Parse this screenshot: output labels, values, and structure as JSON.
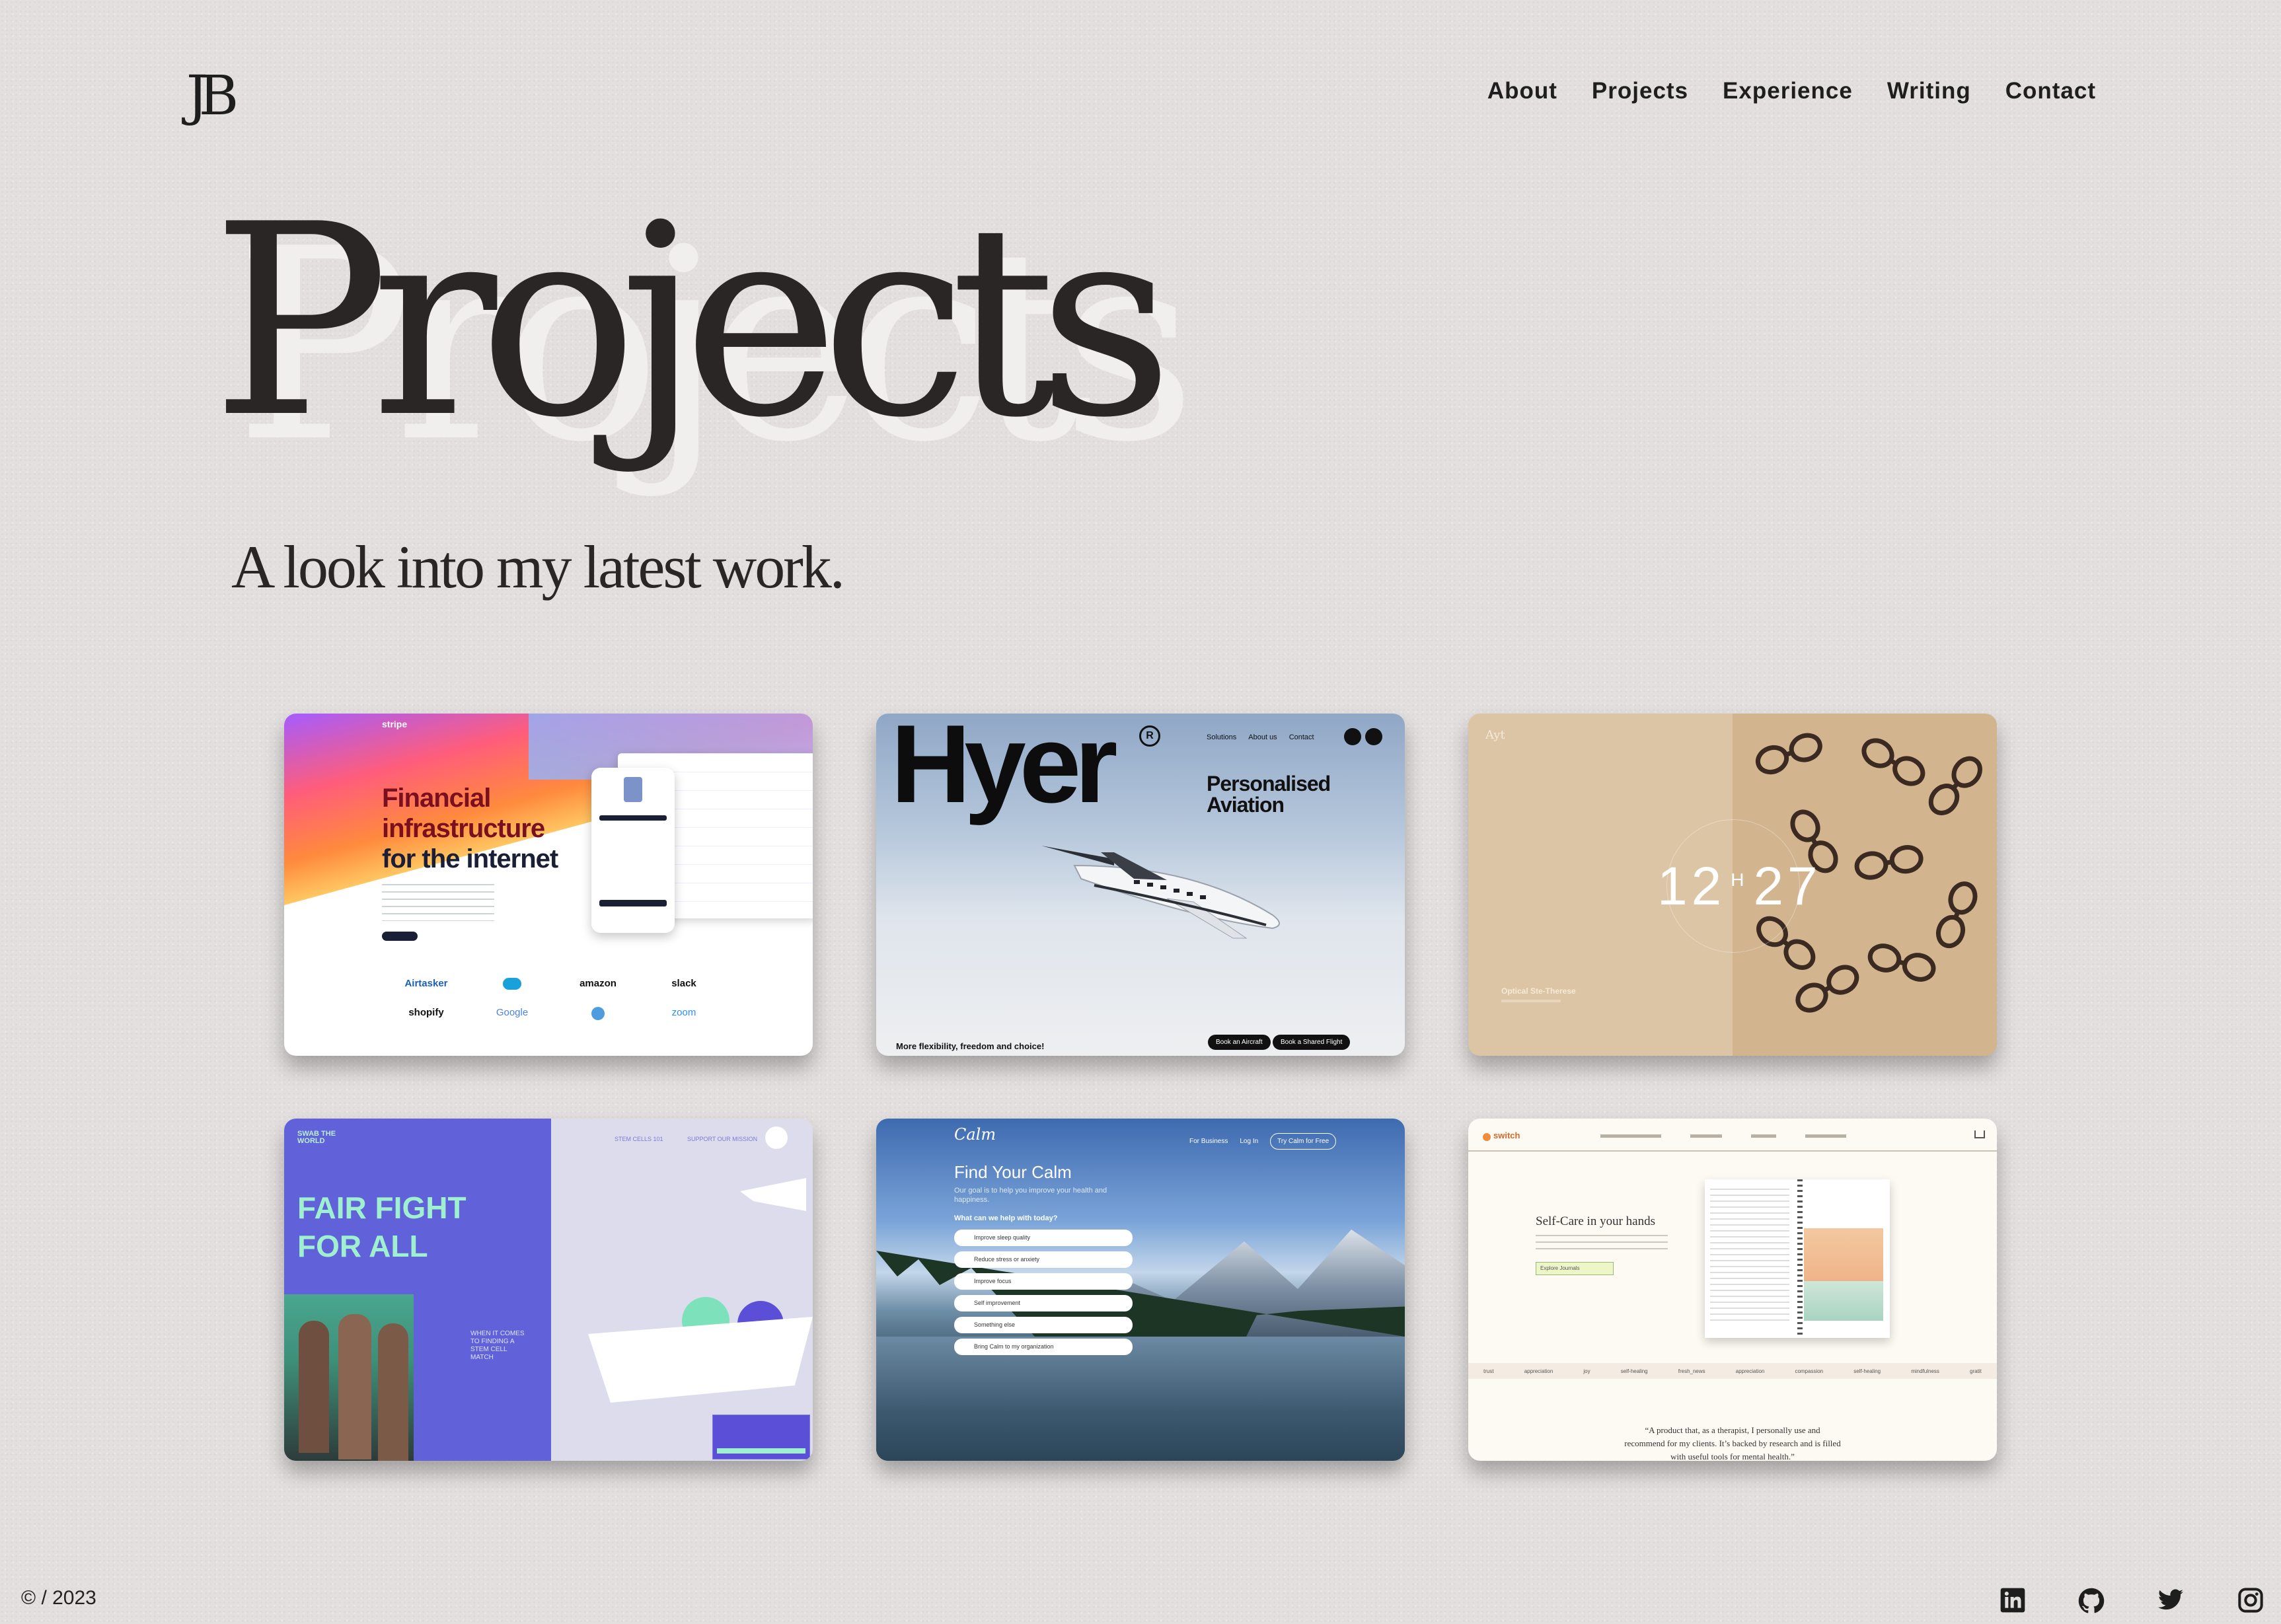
{
  "logo": "JB",
  "nav": [
    "About",
    "Projects",
    "Experience",
    "Writing",
    "Contact"
  ],
  "hero": {
    "title": "Projects",
    "subtitle": "A look into my latest work."
  },
  "projects": {
    "stripe": {
      "headline1": "Financial",
      "headline2": "infrastructure",
      "headline3": "for the internet",
      "brand": "stripe",
      "logos": [
        "Airtasker",
        "amazon",
        "slack",
        "shopify",
        "Google",
        "zoom"
      ]
    },
    "hyer": {
      "brand": "Hyer",
      "tagline1": "Personalised",
      "tagline2": "Aviation",
      "footer": "More flexibility, freedom and choice!",
      "nav": [
        "Solutions",
        "About us",
        "Contact"
      ],
      "btn1": "Book an Aircraft",
      "btn2": "Book a Shared Flight"
    },
    "optical": {
      "time": "12",
      "unit": "H",
      "minutes": "27",
      "label": "Optical Ste-Therese"
    },
    "swab": {
      "brand": "SWAB THE WORLD",
      "headline1": "FAIR FIGHT",
      "headline2": "FOR ALL",
      "nav1": "STEM CELLS 101",
      "nav2": "SUPPORT OUR MISSION",
      "caption": "WHEN IT COMES TO FINDING A STEM CELL MATCH"
    },
    "calm": {
      "brand": "Calm",
      "title": "Find Your Calm",
      "sub": "Our goal is to help you improve your health and happiness.",
      "question": "What can we help with today?",
      "options": [
        "Improve sleep quality",
        "Reduce stress or anxiety",
        "Improve focus",
        "Self improvement",
        "Something else",
        "Bring Calm to my organization"
      ],
      "nav": [
        "For Business",
        "Log In",
        "Try Calm for Free"
      ]
    },
    "switch": {
      "brand": "switch",
      "title": "Self-Care in your hands",
      "quote1": "“A product that, as a therapist, I personally use and",
      "quote2": "recommend for my clients. It’s backed by research and is filled",
      "quote3": "with useful tools for mental health.”",
      "cta": "Explore Journals",
      "categories": [
        "trust",
        "appreciation",
        "joy",
        "self-healing",
        "fresh_news",
        "appreciation",
        "compassion",
        "self-healing",
        "mindfulness",
        "gratit"
      ]
    }
  },
  "footer": {
    "copyright": "© / 2023",
    "social": [
      "linkedin-icon",
      "github-icon",
      "twitter-icon",
      "instagram-icon"
    ]
  }
}
